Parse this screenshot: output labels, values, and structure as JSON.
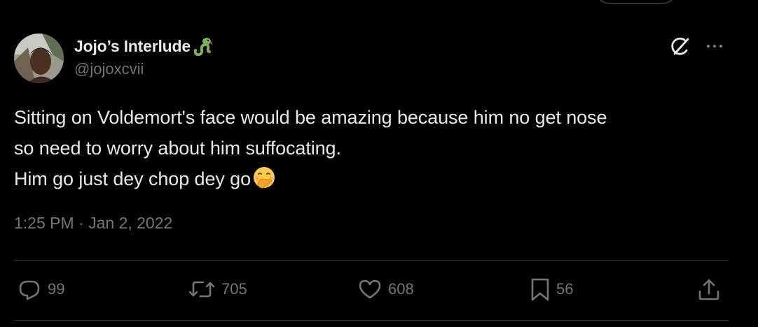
{
  "author": {
    "display_name": "Jojo’s Interlude",
    "handle": "@jojoxcvii",
    "name_emoji": "snake-icon"
  },
  "tweet": {
    "lines": [
      "Sitting on Voldemort's face would be amazing because him no get nose",
      "so need to worry about him suffocating.",
      "Him go just dey chop dey go"
    ],
    "trailing_emoji": "face-with-hand-over-mouth-icon",
    "timestamp": "1:25 PM · Jan 2, 2022"
  },
  "actions": {
    "replies": "99",
    "reposts": "705",
    "likes": "608",
    "bookmarks": "56"
  },
  "colors": {
    "background": "#000000",
    "primary_text": "#e7e9ea",
    "secondary_text": "#71767b",
    "divider": "#2f3336",
    "snake_green": "#78b159",
    "emoji_yellow": "#ffcc4d"
  }
}
